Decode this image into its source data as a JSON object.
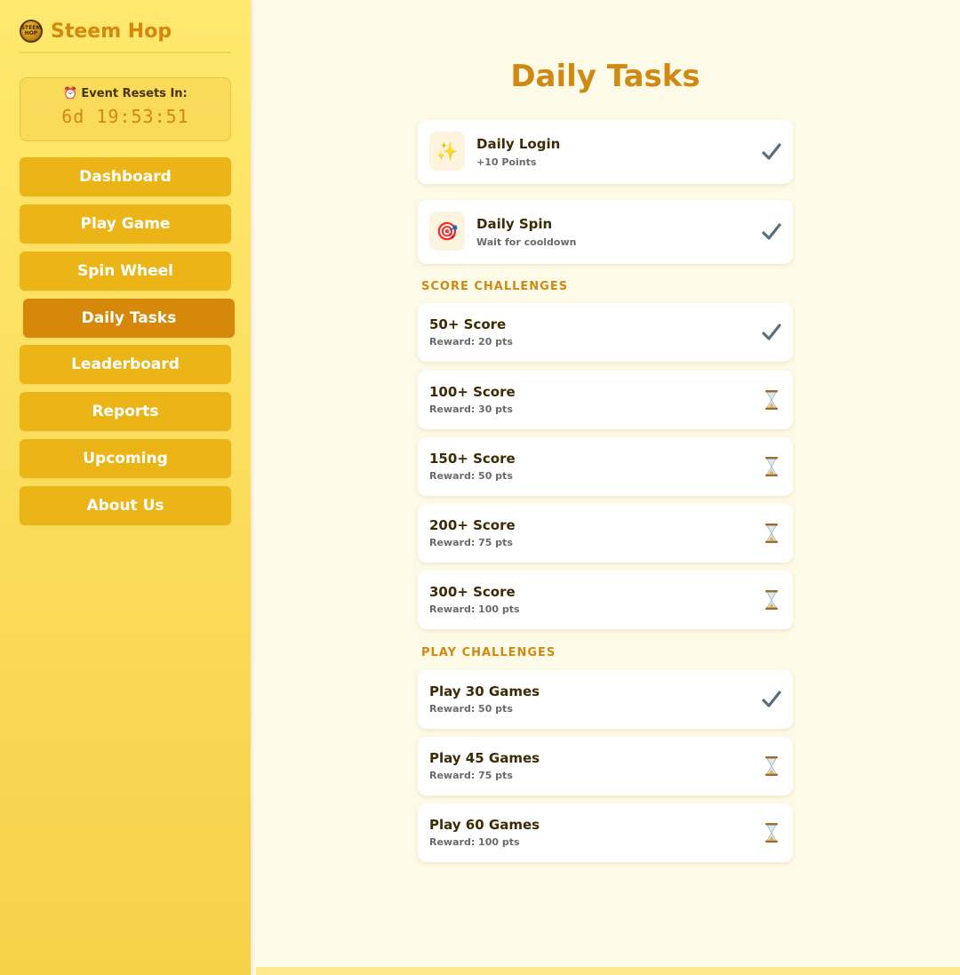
{
  "app": {
    "name": "Steem Hop",
    "logo_text": "STEEM HOP"
  },
  "timer": {
    "label": "Event Resets In:",
    "value": "6d 19:53:51"
  },
  "nav": {
    "items": [
      {
        "label": "Dashboard"
      },
      {
        "label": "Play Game"
      },
      {
        "label": "Spin Wheel"
      },
      {
        "label": "Daily Tasks",
        "active": true
      },
      {
        "label": "Leaderboard"
      },
      {
        "label": "Reports"
      },
      {
        "label": "Upcoming"
      },
      {
        "label": "About Us"
      }
    ]
  },
  "page": {
    "title": "Daily Tasks"
  },
  "daily": [
    {
      "title": "Daily Login",
      "subtitle": "+10 Points",
      "icon": "sparkles-icon",
      "status": "done"
    },
    {
      "title": "Daily Spin",
      "subtitle": "Wait for cooldown",
      "icon": "target-icon",
      "status": "done"
    }
  ],
  "score_section": {
    "heading": "SCORE CHALLENGES"
  },
  "score_challenges": [
    {
      "title": "50+ Score",
      "reward": "Reward: 20 pts",
      "status": "done"
    },
    {
      "title": "100+ Score",
      "reward": "Reward: 30 pts",
      "status": "pending"
    },
    {
      "title": "150+ Score",
      "reward": "Reward: 50 pts",
      "status": "pending"
    },
    {
      "title": "200+ Score",
      "reward": "Reward: 75 pts",
      "status": "pending"
    },
    {
      "title": "300+ Score",
      "reward": "Reward: 100 pts",
      "status": "pending"
    }
  ],
  "play_section": {
    "heading": "PLAY CHALLENGES"
  },
  "play_challenges": [
    {
      "title": "Play 30 Games",
      "reward": "Reward: 50 pts",
      "status": "done"
    },
    {
      "title": "Play 45 Games",
      "reward": "Reward: 75 pts",
      "status": "pending"
    },
    {
      "title": "Play 60 Games",
      "reward": "Reward: 100 pts",
      "status": "pending"
    }
  ],
  "colors": {
    "accent": "#d08a14",
    "nav_button": "#ecb517",
    "nav_active": "#d5880a",
    "check": "#5a6f7d",
    "background": "#fefae8"
  }
}
